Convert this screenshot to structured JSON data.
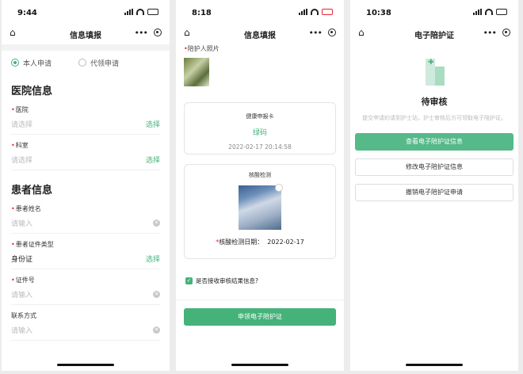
{
  "screens": [
    {
      "time": "9:44",
      "battery": "",
      "title": "信息填报",
      "radio_self": "本人申请",
      "radio_proxy": "代领申请",
      "section_hospital": "医院信息",
      "hospital_label": "医院",
      "hospital_placeholder": "请选择",
      "hospital_pick": "选择",
      "dept_label": "科室",
      "dept_placeholder": "请选择",
      "dept_pick": "选择",
      "section_patient": "患者信息",
      "name_label": "患者姓名",
      "name_placeholder": "请输入",
      "idtype_label": "患者证件类型",
      "idtype_value": "身份证",
      "idtype_pick": "选择",
      "idno_label": "证件号",
      "idno_placeholder": "请输入",
      "contact_label": "联系方式",
      "contact_placeholder": "请输入"
    },
    {
      "time": "8:18",
      "title": "信息填报",
      "photo_label": "陪护人照片",
      "health_card_title": "健康申报卡",
      "health_code": "绿码",
      "health_datetime": "2022-02-17 20:14:58",
      "nucleic_title": "核酸检测",
      "nucleic_date_label": "核酸检测日期：",
      "nucleic_date": "2022-02-17",
      "consent_label": "是否接收审核结果信息?",
      "submit_label": "申领电子陪护证"
    },
    {
      "time": "10:38",
      "title": "电子陪护证",
      "status_title": "待审核",
      "status_desc": "提交申请的请到护士站，护士审核后方可领取电子陪护证。",
      "btn_view": "查看电子陪护证信息",
      "btn_edit": "修改电子陪护证信息",
      "btn_cancel": "撤销电子陪护证申请"
    }
  ],
  "colors": {
    "accent": "#45b27a",
    "required": "#e23333"
  },
  "icons": [
    "home-icon",
    "more-icon",
    "target-icon",
    "clear-icon",
    "check-icon",
    "hospital-illustration-icon"
  ]
}
